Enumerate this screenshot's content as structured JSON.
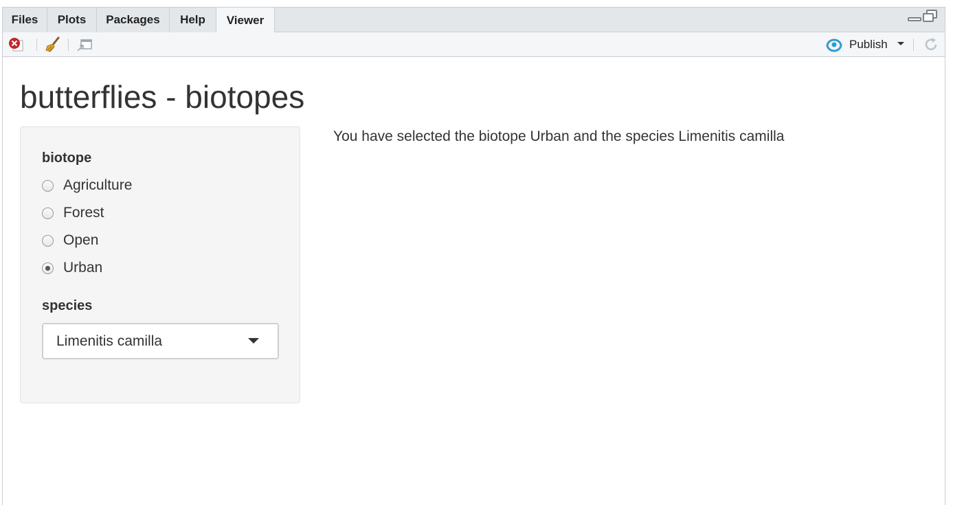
{
  "tabs": [
    {
      "label": "Files",
      "active": false
    },
    {
      "label": "Plots",
      "active": false
    },
    {
      "label": "Packages",
      "active": false
    },
    {
      "label": "Help",
      "active": false
    },
    {
      "label": "Viewer",
      "active": true
    }
  ],
  "toolbar": {
    "publish_label": "Publish",
    "icons": [
      "close-icon",
      "clear-broom-icon",
      "popout-icon",
      "publish-icon",
      "refresh-icon"
    ]
  },
  "app": {
    "title": "butterflies - biotopes",
    "biotope_label": "biotope",
    "biotope_options": [
      {
        "label": "Agriculture",
        "checked": false
      },
      {
        "label": "Forest",
        "checked": false
      },
      {
        "label": "Open",
        "checked": false
      },
      {
        "label": "Urban",
        "checked": true
      }
    ],
    "species_label": "species",
    "species_selected": "Limenitis camilla",
    "output_text": "You have selected the biotope Urban and the species Limenitis camilla"
  },
  "colors": {
    "publish_accent": "#2f9bd5",
    "close_red": "#c0272d",
    "text": "#333333",
    "sidebar_bg": "#f5f5f5"
  }
}
